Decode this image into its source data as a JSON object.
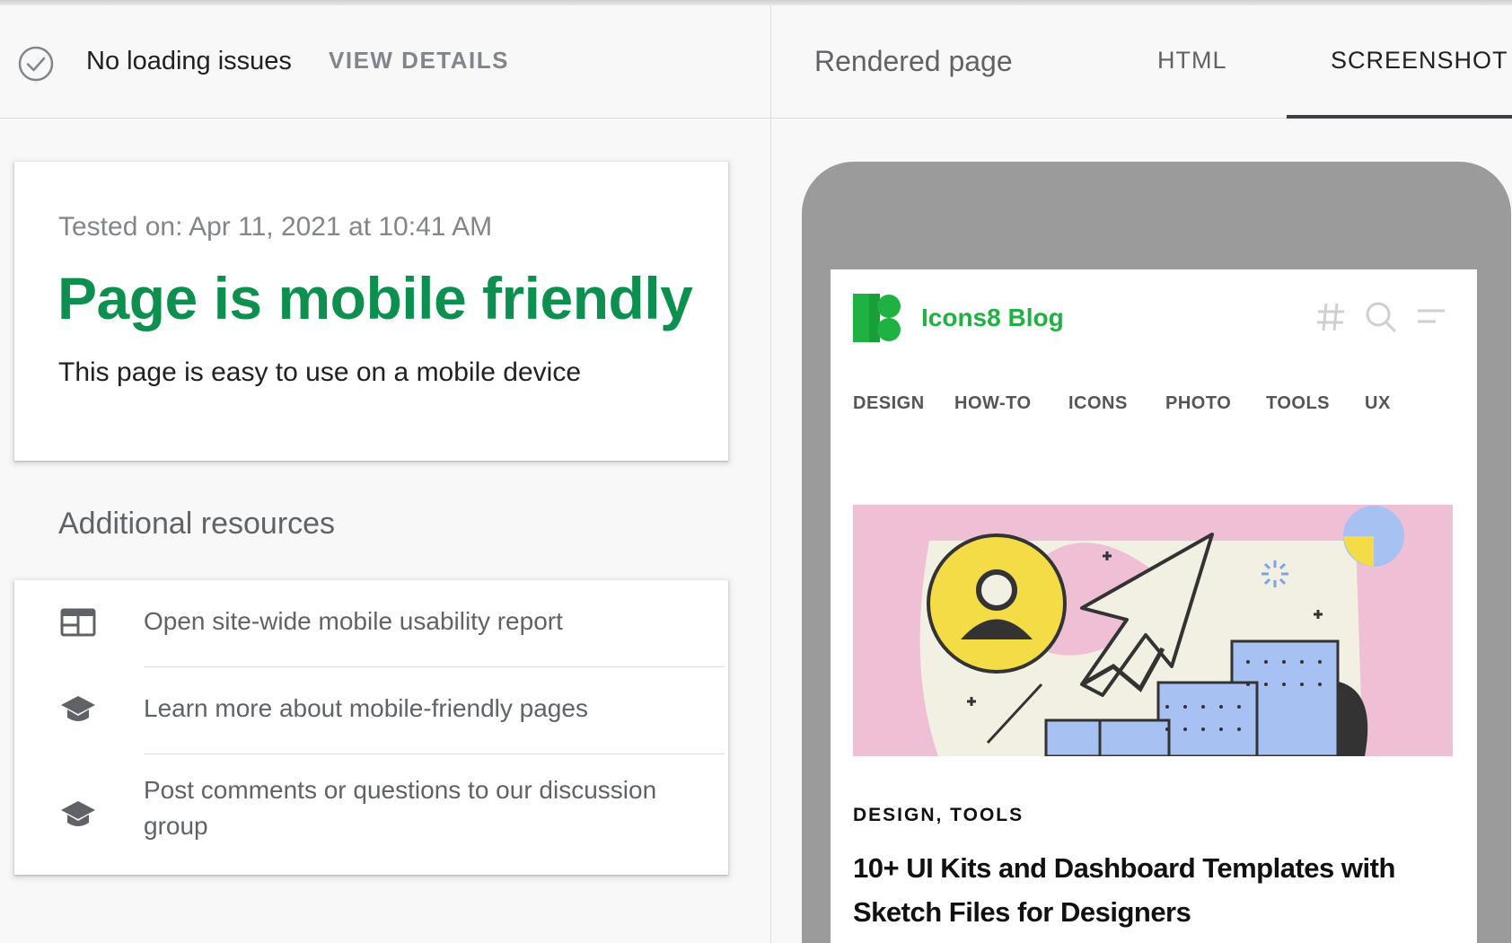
{
  "status": {
    "icon": "check-circle-icon",
    "text": "No loading issues",
    "view_details": "VIEW DETAILS"
  },
  "result": {
    "tested_on": "Tested on: Apr 11, 2021 at 10:41 AM",
    "headline": "Page is mobile friendly",
    "subline": "This page is easy to use on a mobile device",
    "headline_color": "#0d904f"
  },
  "additional": {
    "title": "Additional resources",
    "items": [
      {
        "icon": "report-icon",
        "label": "Open site-wide mobile usability report"
      },
      {
        "icon": "graduation-cap-icon",
        "label": "Learn more about mobile-friendly pages"
      },
      {
        "icon": "graduation-cap-icon",
        "label": "Post comments or questions to our discussion group"
      }
    ]
  },
  "right_header": {
    "title": "Rendered page",
    "tabs": [
      {
        "label": "HTML",
        "active": false
      },
      {
        "label": "SCREENSHOT",
        "active": true
      }
    ]
  },
  "screenshot": {
    "blog_name": "Icons8 Blog",
    "brand_color": "#1fb141",
    "header_icons": [
      "hashtag-icon",
      "search-icon",
      "menu-icon"
    ],
    "nav": [
      "DESIGN",
      "HOW-TO",
      "ICONS",
      "PHOTO",
      "TOOLS",
      "UX"
    ],
    "categories": "DESIGN, TOOLS",
    "post_title": "10+ UI Kits and Dashboard Templates with Sketch Files for Designers"
  }
}
